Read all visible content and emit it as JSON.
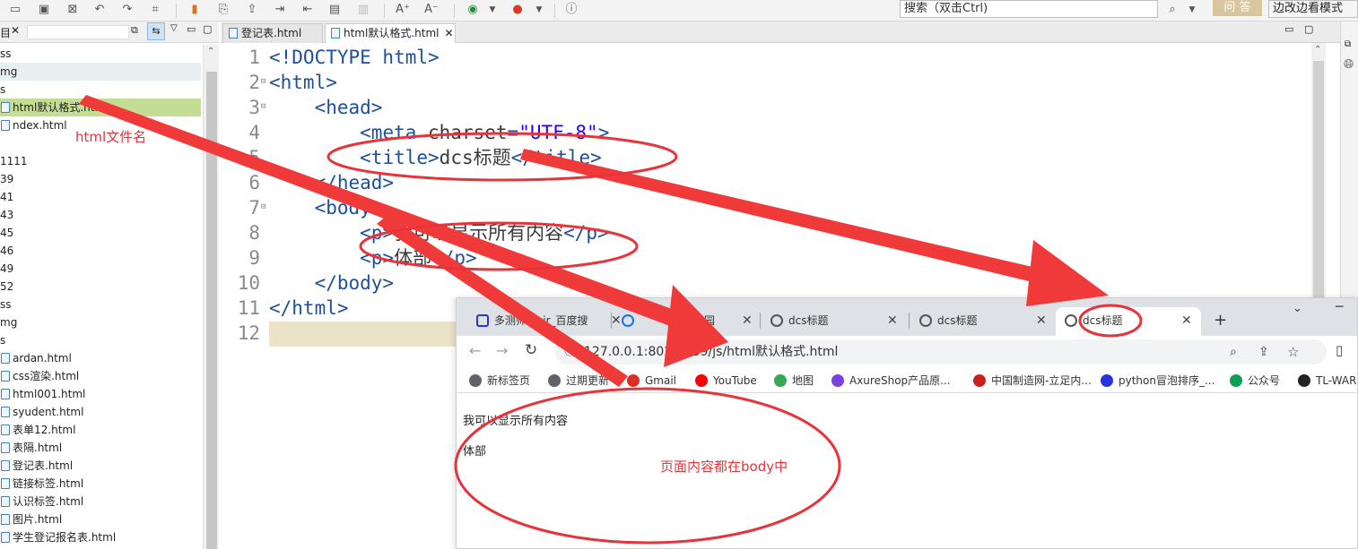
{
  "toolbar": {
    "search_placeholder": "搜索（双击Ctrl)",
    "ask_label": "问 答",
    "mode_label": "边改边看模式"
  },
  "tree": {
    "rows": [
      {
        "label": "ss",
        "type": "folder"
      },
      {
        "label": "mg",
        "type": "folder"
      },
      {
        "label": "s",
        "type": "folder"
      },
      {
        "label": "html默认格式.html",
        "type": "file"
      },
      {
        "label": "ndex.html",
        "type": "file"
      },
      {
        "label": "",
        "type": "blank"
      },
      {
        "label": "1111",
        "type": "folder"
      },
      {
        "label": "39",
        "type": "folder"
      },
      {
        "label": "41",
        "type": "folder"
      },
      {
        "label": "43",
        "type": "folder"
      },
      {
        "label": "45",
        "type": "folder"
      },
      {
        "label": "46",
        "type": "folder"
      },
      {
        "label": "49",
        "type": "folder"
      },
      {
        "label": "52",
        "type": "folder"
      },
      {
        "label": "ss",
        "type": "folder"
      },
      {
        "label": "mg",
        "type": "folder"
      },
      {
        "label": "s",
        "type": "folder"
      },
      {
        "label": "ardan.html",
        "type": "file"
      },
      {
        "label": "css渲染.html",
        "type": "file"
      },
      {
        "label": "html001.html",
        "type": "file"
      },
      {
        "label": "syudent.html",
        "type": "file"
      },
      {
        "label": "表单12.html",
        "type": "file"
      },
      {
        "label": "表隔.html",
        "type": "file"
      },
      {
        "label": "登记表.html",
        "type": "file"
      },
      {
        "label": "链接标签.html",
        "type": "file"
      },
      {
        "label": "认识标签.html",
        "type": "file"
      },
      {
        "label": "图片.html",
        "type": "file"
      },
      {
        "label": "学生登记报名表.html",
        "type": "file"
      }
    ]
  },
  "editor_tabs": [
    {
      "label": "登记表.html",
      "active": false
    },
    {
      "label": "html默认格式.html",
      "active": true
    }
  ],
  "code": {
    "line_numbers": [
      "1",
      "2",
      "3",
      "4",
      "5",
      "6",
      "7",
      "8",
      "9",
      "10",
      "11",
      "12"
    ],
    "lines": [
      {
        "indent": "",
        "parts": [
          [
            "tag",
            "<!DOCTYPE html>"
          ]
        ]
      },
      {
        "indent": "",
        "parts": [
          [
            "tag",
            "<html>"
          ]
        ]
      },
      {
        "indent": "    ",
        "parts": [
          [
            "tag",
            "<head>"
          ]
        ]
      },
      {
        "indent": "        ",
        "parts": [
          [
            "tag",
            "<meta "
          ],
          [
            "kw",
            "charset"
          ],
          [
            "tag",
            "="
          ],
          [
            "str",
            "\"UTF-8\""
          ],
          [
            "tag",
            ">"
          ]
        ]
      },
      {
        "indent": "        ",
        "parts": [
          [
            "tag",
            "<title>"
          ],
          [
            "kw",
            "dcs标题"
          ],
          [
            "tag",
            "</title>"
          ]
        ]
      },
      {
        "indent": "    ",
        "parts": [
          [
            "tag",
            "</head>"
          ]
        ]
      },
      {
        "indent": "    ",
        "parts": [
          [
            "tag",
            "<body>"
          ]
        ]
      },
      {
        "indent": "        ",
        "parts": [
          [
            "tag",
            "<p>"
          ],
          [
            "kw",
            "我可以显示所有内容"
          ],
          [
            "tag",
            "</p>"
          ]
        ]
      },
      {
        "indent": "        ",
        "parts": [
          [
            "tag",
            "<p>"
          ],
          [
            "kw",
            "体部"
          ],
          [
            "tag",
            "</p>"
          ]
        ]
      },
      {
        "indent": "    ",
        "parts": [
          [
            "tag",
            "</body>"
          ]
        ]
      },
      {
        "indent": "",
        "parts": [
          [
            "tag",
            "</html>"
          ]
        ]
      },
      {
        "indent": "",
        "parts": []
      }
    ]
  },
  "browser": {
    "tabs": [
      {
        "label": "多测师肖sir_百度搜",
        "active": false
      },
      {
        "label": "客园",
        "active": false
      },
      {
        "label": "dcs标题",
        "active": false
      },
      {
        "label": "dcs标题",
        "active": false
      },
      {
        "label": "dcs标题",
        "active": true
      }
    ],
    "url": "127.0.0.1:8020/d59/js/html默认格式.html",
    "bookmarks": [
      "新标签页",
      "过期更新",
      "Gmail",
      "YouTube",
      "地图",
      "AxureShop产品原...",
      "中国制造网-立足内...",
      "python冒泡排序_...",
      "公众号",
      "TL-WAR"
    ],
    "content": [
      "我可以显示所有内容",
      "体部"
    ]
  },
  "annotations": {
    "filename_label": "html文件名",
    "body_label": "页面内容都在body中"
  },
  "colors": {
    "annotation_red": "#e8333a",
    "tree_selected": "#c4dd94",
    "tag_blue": "#1f4f9a"
  }
}
